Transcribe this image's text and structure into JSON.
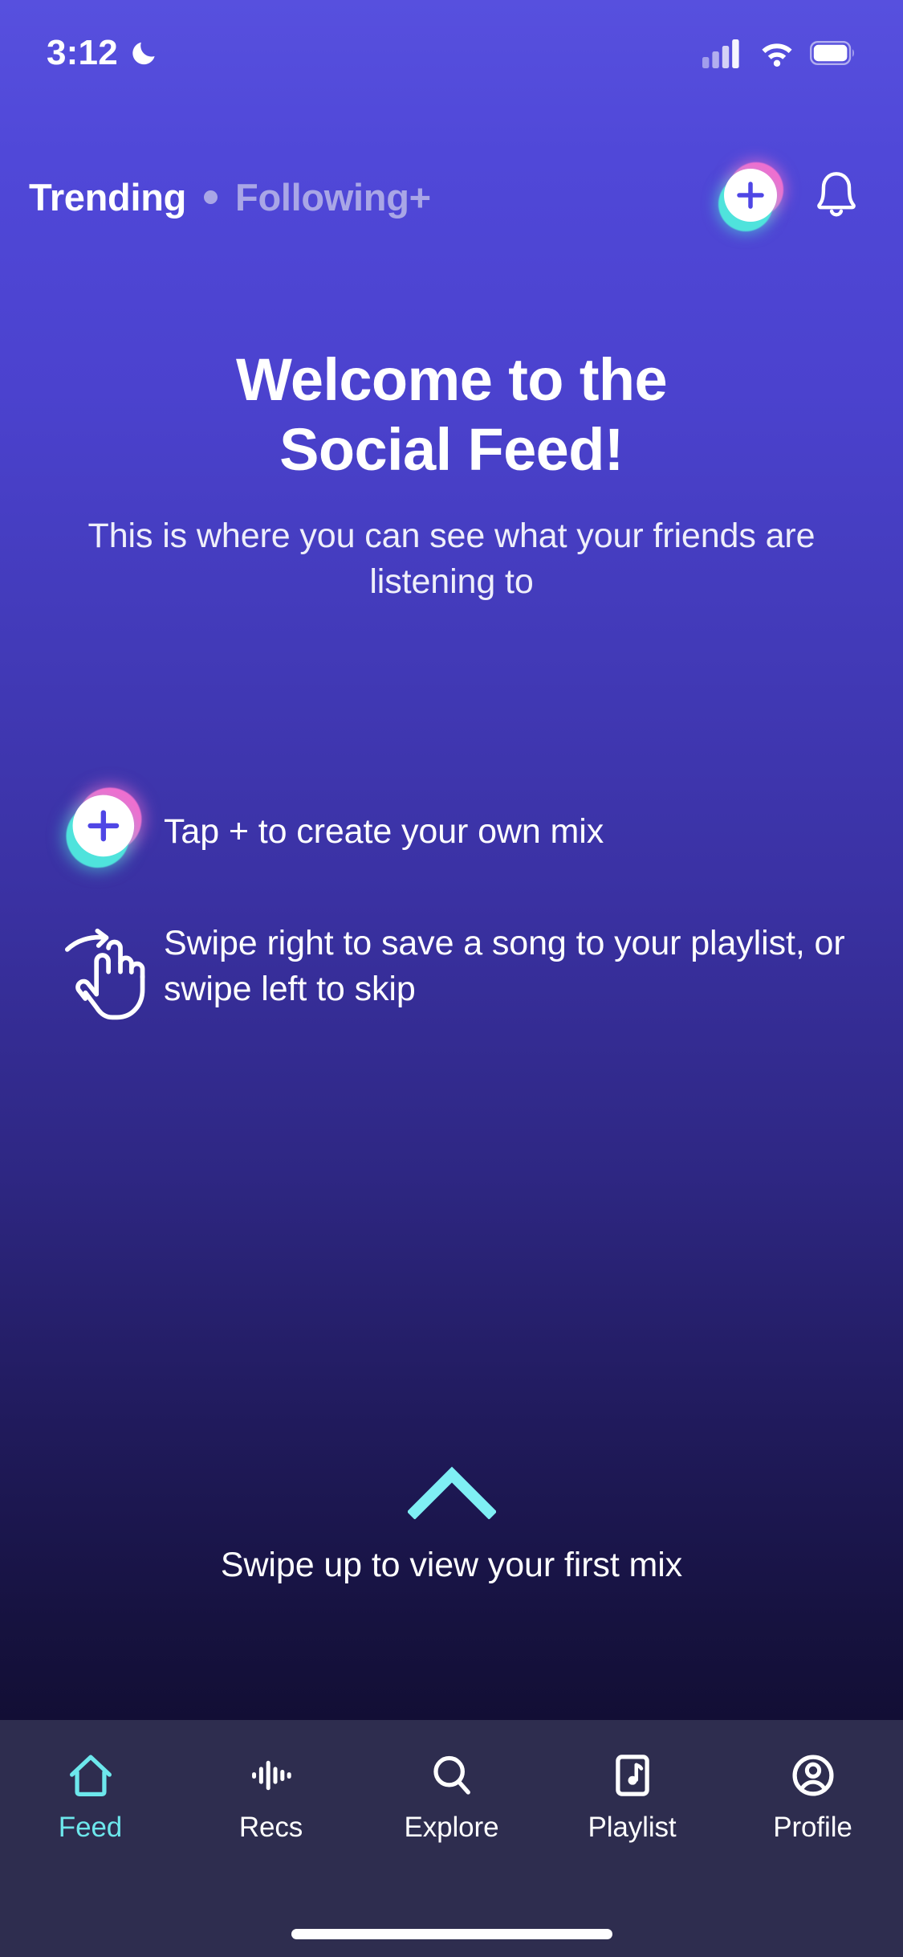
{
  "status_bar": {
    "time": "3:12",
    "dnd_icon": "crescent-moon-icon",
    "signal_icon": "cellular-signal-icon",
    "wifi_icon": "wifi-icon",
    "battery_icon": "battery-icon"
  },
  "top_nav": {
    "tabs": [
      {
        "label": "Trending",
        "active": true
      },
      {
        "label": "Following+",
        "active": false
      }
    ],
    "separator": "dot-separator",
    "create_button": {
      "icon": "plus-icon",
      "label": "+"
    },
    "notifications_button": {
      "icon": "bell-icon"
    }
  },
  "hero": {
    "title_line1": "Welcome to the",
    "title_line2": "Social Feed!",
    "subtitle": "This is where you can see what your friends are listening to"
  },
  "tips": [
    {
      "icon": "plus-circle-icon",
      "text": "Tap + to create your own mix"
    },
    {
      "icon": "swipe-hand-icon",
      "text": "Swipe right to save a song to your playlist, or swipe left to skip"
    }
  ],
  "swipe_up": {
    "icon": "chevron-up-icon",
    "label": "Swipe up to view your first mix"
  },
  "tab_bar": {
    "items": [
      {
        "label": "Feed",
        "icon": "home-icon",
        "active": true
      },
      {
        "label": "Recs",
        "icon": "waveform-icon",
        "active": false
      },
      {
        "label": "Explore",
        "icon": "search-icon",
        "active": false
      },
      {
        "label": "Playlist",
        "icon": "playlist-music-icon",
        "active": false
      },
      {
        "label": "Profile",
        "icon": "person-circle-icon",
        "active": false
      }
    ]
  },
  "home_indicator": "home-indicator-bar",
  "colors": {
    "accent_cyan": "#6DE7EC",
    "accent_pink": "#F06FD0",
    "bg_top": "#5750DE",
    "bg_bottom": "#0C0926",
    "tabbar_bg": "#2E2D4F",
    "plus_glyph": "#4F46E5",
    "muted_nav": "#A9A6E6"
  }
}
